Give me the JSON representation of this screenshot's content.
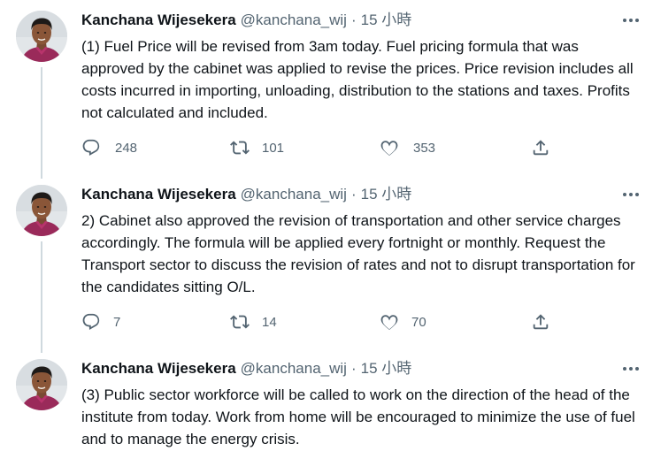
{
  "colors": {
    "text_primary": "#0f1419",
    "text_secondary": "#536471",
    "thread_line": "#cfd9de",
    "background": "#ffffff"
  },
  "tweets": [
    {
      "author": {
        "name": "Kanchana Wijesekera",
        "handle": "@kanchana_wij",
        "avatar_icon": "avatar-photo"
      },
      "separator": "·",
      "timestamp": "15 小時",
      "text": "(1) Fuel Price will be revised from 3am today. Fuel pricing formula that was approved by the cabinet was applied to revise the prices. Price revision includes all costs incurred in importing, unloading, distribution to the stations and taxes. Profits not calculated and included.",
      "replies": "248",
      "retweets": "101",
      "likes": "353"
    },
    {
      "author": {
        "name": "Kanchana Wijesekera",
        "handle": "@kanchana_wij",
        "avatar_icon": "avatar-photo"
      },
      "separator": "·",
      "timestamp": "15 小時",
      "text": "2) Cabinet also approved the revision of transportation and other service charges accordingly. The formula will be applied every fortnight or monthly. Request the Transport sector to discuss the revision of rates and not to disrupt transportation for the candidates sitting O/L.",
      "replies": "7",
      "retweets": "14",
      "likes": "70"
    },
    {
      "author": {
        "name": "Kanchana Wijesekera",
        "handle": "@kanchana_wij",
        "avatar_icon": "avatar-photo"
      },
      "separator": "·",
      "timestamp": "15 小時",
      "text": "(3) Public sector workforce will be called to work on the direction of the head of the institute from today. Work from home will be encouraged to minimize the use of fuel and to manage the energy crisis."
    }
  ],
  "icons": {
    "more": "more-horizontal-icon",
    "reply": "reply-icon",
    "retweet": "retweet-icon",
    "like": "heart-icon",
    "share": "share-icon"
  }
}
